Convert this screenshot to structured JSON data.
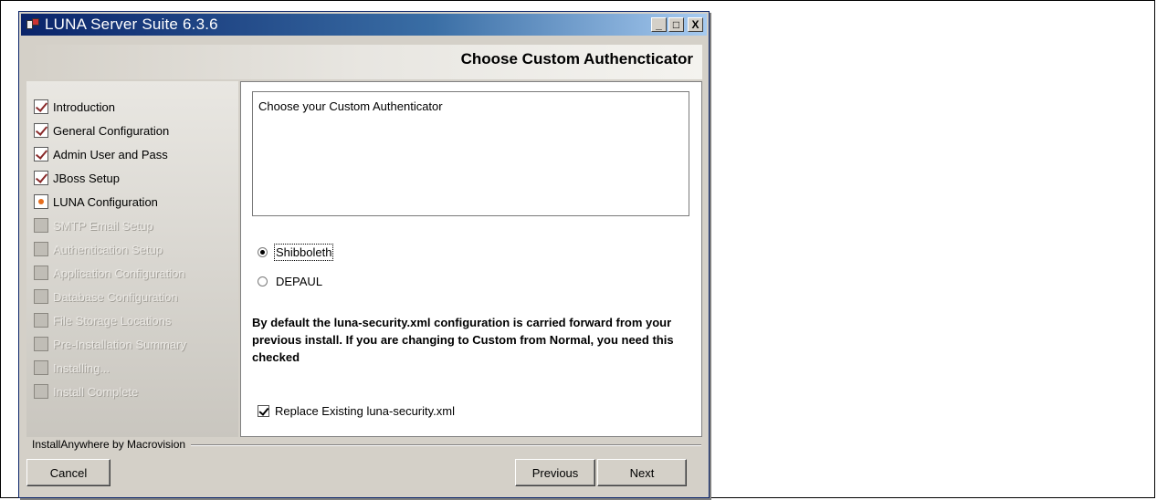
{
  "window": {
    "title": "LUNA Server Suite 6.3.6",
    "controls": {
      "minimize": "_",
      "maximize": "□",
      "close": "X"
    }
  },
  "header": {
    "title": "Choose Custom Authencticator"
  },
  "steps": [
    {
      "label": "Introduction",
      "state": "done"
    },
    {
      "label": "General Configuration",
      "state": "done"
    },
    {
      "label": "Admin User and Pass",
      "state": "done"
    },
    {
      "label": "JBoss Setup",
      "state": "done"
    },
    {
      "label": "LUNA Configuration",
      "state": "current"
    },
    {
      "label": "SMTP Email Setup",
      "state": "pending"
    },
    {
      "label": "Authentication Setup",
      "state": "pending"
    },
    {
      "label": "Application Configuration",
      "state": "pending"
    },
    {
      "label": "Database Configuration",
      "state": "pending"
    },
    {
      "label": "File Storage Locations",
      "state": "pending"
    },
    {
      "label": "Pre-Installation Summary",
      "state": "pending"
    },
    {
      "label": "Installing...",
      "state": "pending"
    },
    {
      "label": "Install Complete",
      "state": "pending"
    }
  ],
  "content": {
    "description": "Choose your Custom Authenticator",
    "options": [
      {
        "label": "Shibboleth",
        "selected": true
      },
      {
        "label": "DEPAUL",
        "selected": false
      }
    ],
    "note": "By default the luna-security.xml configuration is carried forward from your previous install.  If you are changing to Custom from Normal, you need this checked",
    "checkbox": {
      "label": "Replace Existing luna-security.xml",
      "checked": true
    }
  },
  "footer": {
    "vendor": "InstallAnywhere by Macrovision",
    "cancel_label": "Cancel",
    "previous_label": "Previous",
    "next_label": "Next"
  }
}
